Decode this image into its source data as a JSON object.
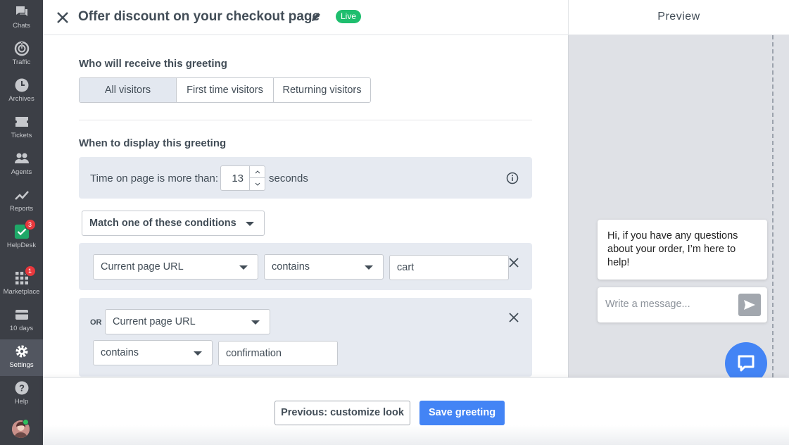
{
  "sidebar": {
    "items": [
      {
        "label": "Chats",
        "icon": "chats-icon"
      },
      {
        "label": "Traffic",
        "icon": "traffic-icon"
      },
      {
        "label": "Archives",
        "icon": "archives-icon"
      },
      {
        "label": "Tickets",
        "icon": "tickets-icon"
      },
      {
        "label": "Agents",
        "icon": "agents-icon"
      },
      {
        "label": "Reports",
        "icon": "reports-icon"
      },
      {
        "label": "HelpDesk",
        "icon": "helpdesk-icon",
        "badge": "3"
      },
      {
        "label": "Marketplace",
        "icon": "marketplace-icon",
        "badge": "1"
      },
      {
        "label": "10 days",
        "icon": "trial-icon"
      },
      {
        "label": "Settings",
        "icon": "settings-icon",
        "active": true
      },
      {
        "label": "Help",
        "icon": "help-icon"
      }
    ]
  },
  "header": {
    "title": "Offer discount on your checkout page",
    "status": "Live"
  },
  "preview": {
    "title": "Preview",
    "greeting_message": "Hi, if you have any questions about your order, I’m here to help!",
    "message_placeholder": "Write a message..."
  },
  "recipients": {
    "label": "Who will receive this greeting",
    "options": [
      "All visitors",
      "First time visitors",
      "Returning visitors"
    ],
    "selected": "All visitors"
  },
  "display": {
    "label": "When to display this greeting",
    "time_label": "Time on page is more than:",
    "time_value": "13",
    "time_unit": "seconds",
    "match_mode": "Match one of these conditions",
    "conditions": [
      {
        "field": "Current page URL",
        "operator": "contains",
        "value": "cart"
      },
      {
        "connector": "OR",
        "field": "Current page URL",
        "operator": "contains",
        "value": "confirmation"
      }
    ]
  },
  "footer": {
    "prev_label": "Previous: customize look",
    "save_label": "Save greeting"
  },
  "colors": {
    "accent": "#4384f5",
    "live": "#1ebe6e",
    "sidebar": "#3c3f46",
    "badge": "#e8383d"
  }
}
